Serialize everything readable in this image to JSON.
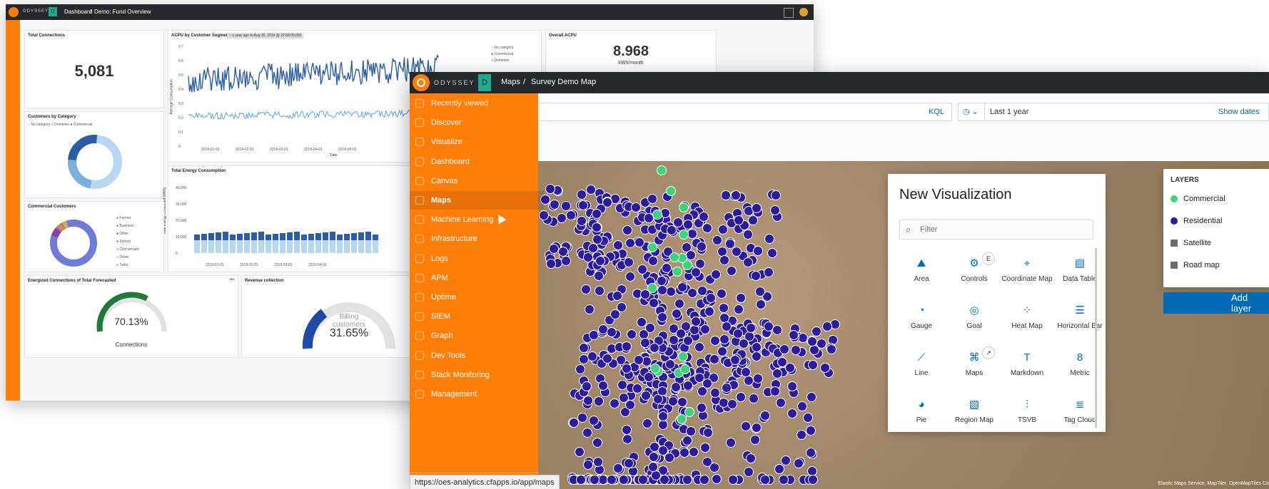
{
  "back_window": {
    "app_name": "ODYSSEY",
    "space_letter": "D",
    "breadcrumb": [
      "Dashboard",
      "Demo: Fund Overview"
    ],
    "panels": {
      "total_connections": {
        "title": "Total Connections",
        "value": "5,081"
      },
      "acpu_segment": {
        "title": "ACPU by Customer Segment",
        "time_badge": "~ a year ago to Aug 30, 2019 @ 22:58:06.050",
        "ylabel": "Average Consumption",
        "xlabel": "Date",
        "yticks": [
          "0.7",
          "0.6",
          "0.5",
          "0.4",
          "0.3",
          "0.2",
          "0.1",
          "0"
        ],
        "xticks": [
          "2018-01-01",
          "2018-02-01",
          "2018-03-01",
          "2018-04-01",
          "2018-05-01"
        ],
        "legend": [
          "No category",
          "Commercial",
          "Domestic"
        ]
      },
      "overall_acpu": {
        "title": "Overall ACPU",
        "value": "8.968",
        "unit": "kWh/month"
      },
      "customers_by_category": {
        "title": "Customers by Category",
        "legend": [
          "No category",
          "Domestic",
          "Commercial"
        ]
      },
      "total_energy": {
        "title": "Total Energy Consumption",
        "ylabel": "Total energy consumed (kWh)",
        "yticks": [
          "40,000",
          "30,000",
          "20,000",
          "10,000",
          "0"
        ],
        "xticks": [
          "2019-01-01",
          "2019-02-01",
          "2019-03-01",
          "2019-04-01"
        ]
      },
      "commercial_customers": {
        "title": "Commercial Customers",
        "legend": [
          "Farmer",
          "Business",
          "Other",
          "School",
          "Civil servant",
          "Driver",
          "Tailor"
        ]
      },
      "energized": {
        "title": "Energized Connections of Total Forecasted",
        "value": "70.13%",
        "label": "Connections"
      },
      "revenue": {
        "title": "Revenue collection",
        "label": "Billing customers",
        "value": "31.65%"
      }
    }
  },
  "front_window": {
    "app_name": "ODYSSEY",
    "space_letter": "D",
    "breadcrumb": [
      "Maps",
      "Survey Demo Map"
    ],
    "query_bar": {
      "language": "KQL",
      "time_range": "Last 1 year",
      "show_dates": "Show dates"
    },
    "nav": [
      {
        "label": "Recently viewed",
        "icon": "clock-icon"
      },
      {
        "label": "Discover",
        "icon": "compass-icon"
      },
      {
        "label": "Visualize",
        "icon": "visualize-icon"
      },
      {
        "label": "Dashboard",
        "icon": "dashboard-icon"
      },
      {
        "label": "Canvas",
        "icon": "canvas-icon"
      },
      {
        "label": "Maps",
        "icon": "maps-icon"
      },
      {
        "label": "Machine Learning",
        "icon": "ml-icon"
      },
      {
        "label": "Infrastructure",
        "icon": "infrastructure-icon"
      },
      {
        "label": "Logs",
        "icon": "logs-icon"
      },
      {
        "label": "APM",
        "icon": "apm-icon"
      },
      {
        "label": "Uptime",
        "icon": "uptime-icon"
      },
      {
        "label": "SIEM",
        "icon": "siem-icon"
      },
      {
        "label": "Graph",
        "icon": "graph-icon"
      },
      {
        "label": "Dev Tools",
        "icon": "devtools-icon"
      },
      {
        "label": "Stack Monitoring",
        "icon": "monitoring-icon"
      },
      {
        "label": "Management",
        "icon": "gear-icon"
      }
    ],
    "status_url": "https://oes-analytics.cfapps.io/app/maps",
    "new_viz": {
      "title": "New Visualization",
      "filter_placeholder": "Filter",
      "tiles": [
        {
          "label": "Area",
          "icon": "area-icon"
        },
        {
          "label": "Controls",
          "icon": "controls-icon",
          "badge": "E"
        },
        {
          "label": "Coordinate Map",
          "icon": "coordinate-map-icon"
        },
        {
          "label": "Data Table",
          "icon": "table-icon"
        },
        {
          "label": "Gauge",
          "icon": "gauge-icon"
        },
        {
          "label": "Goal",
          "icon": "goal-icon"
        },
        {
          "label": "Heat Map",
          "icon": "heatmap-icon"
        },
        {
          "label": "Horizontal Bar",
          "icon": "horizontal-bar-icon"
        },
        {
          "label": "Line",
          "icon": "line-icon"
        },
        {
          "label": "Maps",
          "icon": "maps-icon",
          "badge": "↗"
        },
        {
          "label": "Markdown",
          "icon": "markdown-icon"
        },
        {
          "label": "Metric",
          "icon": "metric-icon"
        },
        {
          "label": "Pie",
          "icon": "pie-icon"
        },
        {
          "label": "Region Map",
          "icon": "region-map-icon"
        },
        {
          "label": "TSVB",
          "icon": "tsvb-icon"
        },
        {
          "label": "Tag Cloud",
          "icon": "tag-cloud-icon"
        }
      ]
    },
    "layers": {
      "title": "LAYERS",
      "items": [
        {
          "label": "Commercial",
          "color": "#3ad47a"
        },
        {
          "label": "Residential",
          "color": "#2b1aa0"
        },
        {
          "label": "Satellite",
          "color": "#6b6b6b"
        },
        {
          "label": "Road map",
          "color": "#6b6b6b"
        }
      ],
      "add_label": "Add layer"
    },
    "attribution": "Elastic Maps Service, MapTiler, OpenMapTiles Co"
  }
}
